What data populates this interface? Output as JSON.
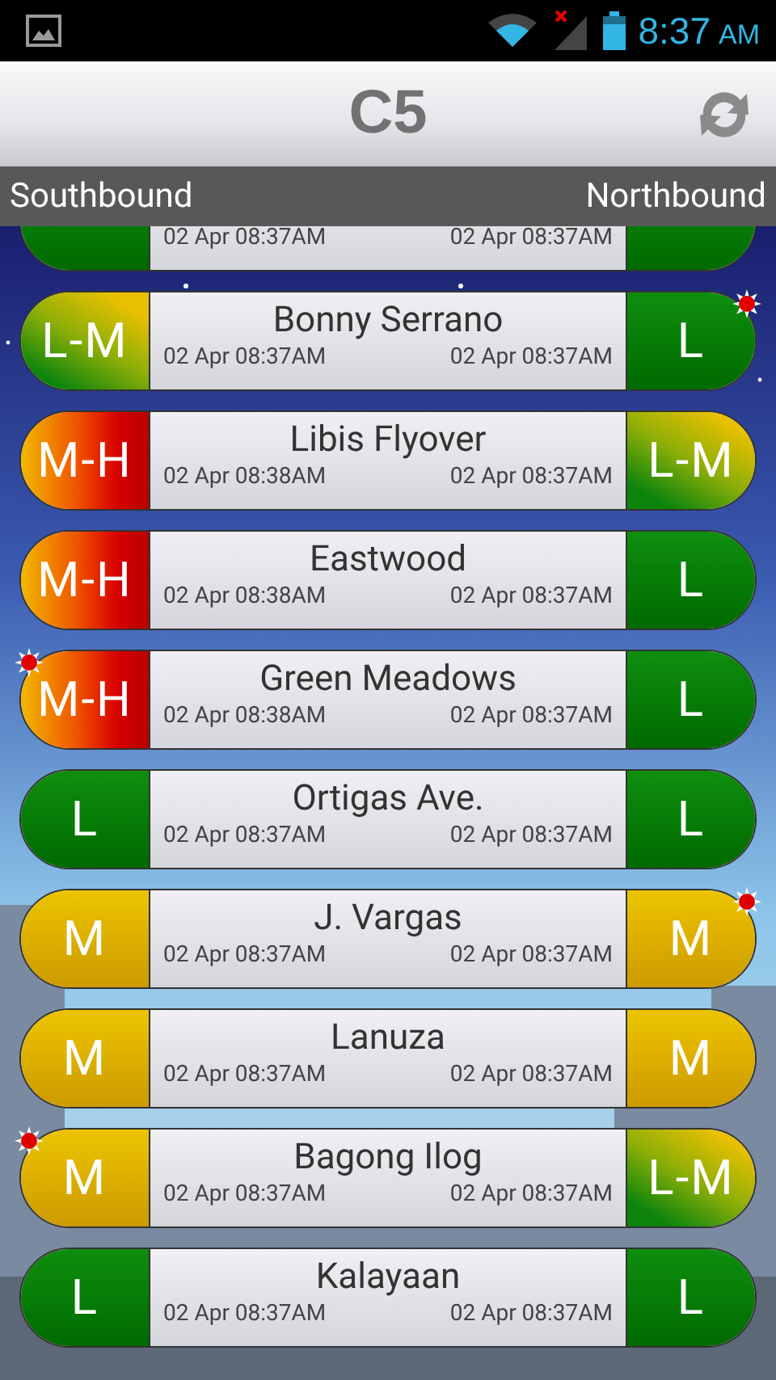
{
  "status_bar": {
    "time": "8:37",
    "meridiem": "AM"
  },
  "header": {
    "title": "C5"
  },
  "directions": {
    "left": "Southbound",
    "right": "Northbound"
  },
  "rows": [
    {
      "south": {
        "kind": "light",
        "alert": false
      },
      "north": {
        "kind": "light",
        "alert": false
      },
      "south_time": "02 Apr 08:37AM",
      "north_time": "02 Apr 08:37AM"
    },
    {
      "name": "Bonny Serrano",
      "south": {
        "status": "L-M",
        "kind": "light-moderate",
        "alert": false
      },
      "north": {
        "status": "L",
        "kind": "light",
        "alert": true
      },
      "south_time": "02 Apr 08:37AM",
      "north_time": "02 Apr 08:37AM"
    },
    {
      "name": "Libis Flyover",
      "south": {
        "status": "M-H",
        "kind": "moderate-heavy",
        "alert": false
      },
      "north": {
        "status": "L-M",
        "kind": "light-moderate",
        "alert": false
      },
      "south_time": "02 Apr 08:38AM",
      "north_time": "02 Apr 08:37AM"
    },
    {
      "name": "Eastwood",
      "south": {
        "status": "M-H",
        "kind": "moderate-heavy",
        "alert": false
      },
      "north": {
        "status": "L",
        "kind": "light",
        "alert": false
      },
      "south_time": "02 Apr 08:38AM",
      "north_time": "02 Apr 08:37AM"
    },
    {
      "name": "Green Meadows",
      "south": {
        "status": "M-H",
        "kind": "moderate-heavy",
        "alert": true
      },
      "north": {
        "status": "L",
        "kind": "light",
        "alert": false
      },
      "south_time": "02 Apr 08:38AM",
      "north_time": "02 Apr 08:37AM"
    },
    {
      "name": "Ortigas Ave.",
      "south": {
        "status": "L",
        "kind": "light",
        "alert": false
      },
      "north": {
        "status": "L",
        "kind": "light",
        "alert": false
      },
      "south_time": "02 Apr 08:37AM",
      "north_time": "02 Apr 08:37AM"
    },
    {
      "name": "J. Vargas",
      "south": {
        "status": "M",
        "kind": "moderate",
        "alert": false
      },
      "north": {
        "status": "M",
        "kind": "moderate",
        "alert": true
      },
      "south_time": "02 Apr 08:37AM",
      "north_time": "02 Apr 08:37AM"
    },
    {
      "name": "Lanuza",
      "south": {
        "status": "M",
        "kind": "moderate",
        "alert": false
      },
      "north": {
        "status": "M",
        "kind": "moderate",
        "alert": false
      },
      "south_time": "02 Apr 08:37AM",
      "north_time": "02 Apr 08:37AM"
    },
    {
      "name": "Bagong Ilog",
      "south": {
        "status": "M",
        "kind": "moderate",
        "alert": true
      },
      "north": {
        "status": "L-M",
        "kind": "light-moderate",
        "alert": false
      },
      "south_time": "02 Apr 08:37AM",
      "north_time": "02 Apr 08:37AM"
    },
    {
      "name": "Kalayaan",
      "south": {
        "status": "L",
        "kind": "light",
        "alert": false
      },
      "north": {
        "status": "L",
        "kind": "light",
        "alert": false
      },
      "south_time": "02 Apr 08:37AM",
      "north_time": "02 Apr 08:37AM"
    }
  ]
}
